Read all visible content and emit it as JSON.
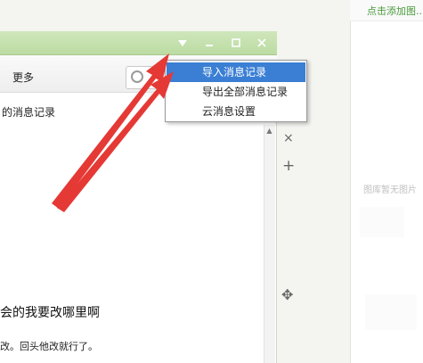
{
  "right_panel": {
    "add_image_link": "点击添加图...",
    "gallery_empty_text": "图库暂无图片"
  },
  "window": {
    "controls": {
      "menu_icon": "triangle-down-icon",
      "minimize_icon": "minimize-icon",
      "maximize_icon": "maximize-icon",
      "close_icon": "close-icon"
    },
    "toolbar": {
      "more_label": "更多"
    },
    "record_label": "的消息记录",
    "messages": [
      "会的我要改哪里啊",
      "改。回头他改就行了。"
    ]
  },
  "side_controls": {
    "close_icon": "×",
    "add_icon": "+",
    "move_icon": "✥"
  },
  "menu": {
    "items": [
      {
        "label": "导入消息记录",
        "selected": true
      },
      {
        "label": "导出全部消息记录",
        "selected": false
      },
      {
        "label": "云消息设置",
        "selected": false
      }
    ]
  },
  "colors": {
    "title_bar": "#c4e1ab",
    "menu_highlight": "#3a7fd4",
    "arrow": "#e53935",
    "link_green": "#4a9a3c"
  }
}
